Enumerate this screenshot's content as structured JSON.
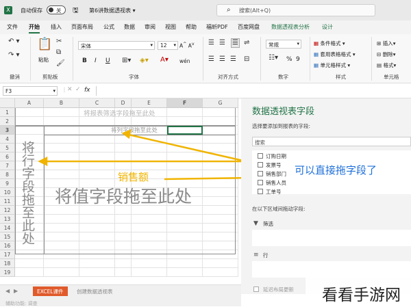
{
  "titlebar": {
    "autosave_label": "自动保存",
    "toggle_state": "关",
    "filename": "第6讲数据透视表",
    "search_placeholder": "搜索(Alt+Q)"
  },
  "tabs": [
    "文件",
    "开始",
    "插入",
    "页面布局",
    "公式",
    "数据",
    "审阅",
    "视图",
    "帮助",
    "福昕PDF",
    "百度网盘",
    "数据透视表分析",
    "设计"
  ],
  "ribbon": {
    "undo_group": "撤消",
    "paste_label": "粘贴",
    "clipboard_group": "剪贴板",
    "font_name": "宋体",
    "font_size": "12",
    "font_group": "字体",
    "bold": "B",
    "italic": "I",
    "underline": "U",
    "wen": "wén",
    "align_group": "对齐方式",
    "number_format": "常规",
    "percent": "%",
    "comma": "9",
    "number_group": "数字",
    "cond_format": "条件格式",
    "table_format": "套用表格格式",
    "cell_style": "单元格样式",
    "style_group": "样式",
    "insert": "插入",
    "delete": "删除",
    "format": "格式",
    "cells_group": "单元格"
  },
  "formula_bar": {
    "name_box": "F3",
    "fx": "fx"
  },
  "grid": {
    "columns": [
      "A",
      "B",
      "C",
      "D",
      "E",
      "F",
      "G"
    ],
    "rows": [
      "1",
      "2",
      "3",
      "4",
      "5",
      "6",
      "7",
      "8",
      "9",
      "10",
      "11",
      "12",
      "13",
      "14",
      "15",
      "16",
      "17",
      "18",
      "19"
    ],
    "report_filter_hint": "将报表筛选字段拖至此处",
    "column_hint": "将列字段拖至此处",
    "row_hint": "将行字段拖至此处",
    "value_hint": "将值字段拖至此处",
    "annotation_sales": "销售额"
  },
  "pane": {
    "title": "数据透视表字段",
    "subtitle": "选择要添加到报表的字段:",
    "search_placeholder": "搜索",
    "fields": [
      "订购日期",
      "发票号",
      "销售部门",
      "销售人员",
      "工单号"
    ],
    "drag_hint": "在以下区域间拖动字段:",
    "filter_area": "筛选",
    "row_area": "行",
    "defer_update": "延迟布局更新",
    "annotation_callout": "可以直接拖字段了"
  },
  "statusbar": {
    "sheet1": "EXCEL课件",
    "sheet2": "创建数据透视表",
    "status": "辅助功能: 调查"
  },
  "watermark": "看看手游网",
  "colors": {
    "excel_green": "#217346",
    "annotation_yellow": "#f0b400",
    "callout_blue": "#1e6fd9"
  }
}
